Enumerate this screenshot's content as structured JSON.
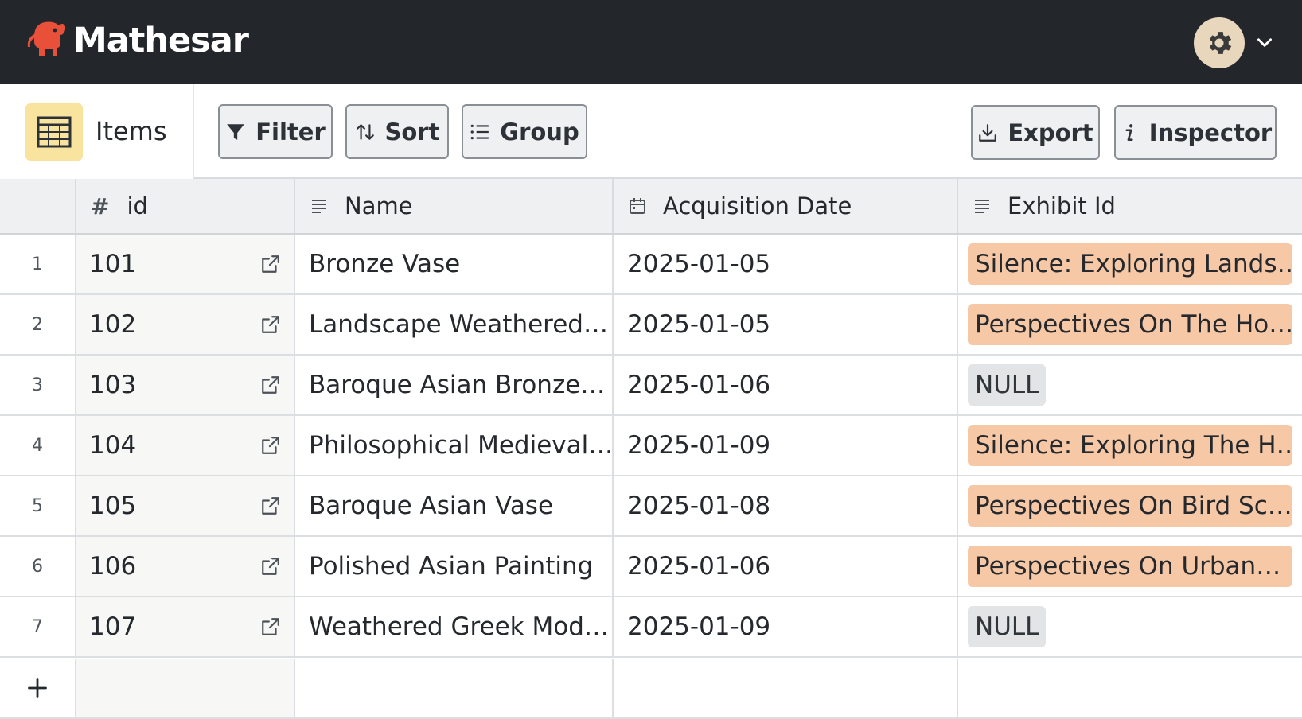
{
  "app": {
    "brand": "Mathesar",
    "logo_icon": "elephant-logo-icon",
    "settings_icon": "gear-icon",
    "colors": {
      "topbar": "#23272c",
      "logo": "#e8503a",
      "settings_bg": "#e9d7bd"
    }
  },
  "toolbar": {
    "table_name": "Items",
    "table_icon": "table-icon",
    "filter_label": "Filter",
    "sort_label": "Sort",
    "group_label": "Group",
    "export_label": "Export",
    "inspector_label": "Inspector"
  },
  "grid": {
    "columns": [
      {
        "key": "id",
        "label": "id",
        "icon": "hash-icon"
      },
      {
        "key": "name",
        "label": "Name",
        "icon": "text-lines-icon"
      },
      {
        "key": "date",
        "label": "Acquisition Date",
        "icon": "calendar-icon"
      },
      {
        "key": "exhibit",
        "label": "Exhibit Id",
        "icon": "text-lines-icon"
      }
    ],
    "rows": [
      {
        "num": "1",
        "id": "101",
        "name": "Bronze Vase",
        "date": "2025-01-05",
        "exhibit": "Silence: Exploring Lands…"
      },
      {
        "num": "2",
        "id": "102",
        "name": "Landscape Weathered…",
        "date": "2025-01-05",
        "exhibit": "Perspectives On The Ho…"
      },
      {
        "num": "3",
        "id": "103",
        "name": "Baroque Asian Bronze…",
        "date": "2025-01-06",
        "exhibit": "NULL"
      },
      {
        "num": "4",
        "id": "104",
        "name": "Philosophical Medieval…",
        "date": "2025-01-09",
        "exhibit": "Silence: Exploring The H…"
      },
      {
        "num": "5",
        "id": "105",
        "name": "Baroque Asian Vase",
        "date": "2025-01-08",
        "exhibit": "Perspectives On Bird Sc…"
      },
      {
        "num": "6",
        "id": "106",
        "name": "Polished Asian Painting",
        "date": "2025-01-06",
        "exhibit": "Perspectives On Urban…"
      },
      {
        "num": "7",
        "id": "107",
        "name": "Weathered Greek Mod…",
        "date": "2025-01-09",
        "exhibit": "NULL"
      }
    ],
    "add_row_icon": "plus-icon",
    "row_link_icon": "external-link-icon"
  }
}
